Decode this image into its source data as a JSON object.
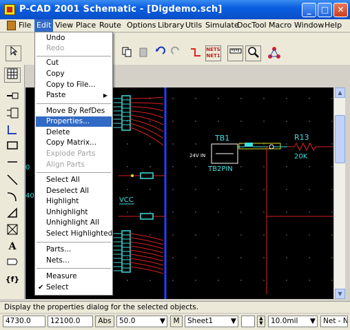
{
  "window": {
    "title": "P-CAD 2001 Schematic - [Digdemo.sch]"
  },
  "menubar": {
    "items": [
      "File",
      "Edit",
      "View",
      "Place",
      "Route",
      "Options",
      "Library",
      "Utils",
      "Simulate",
      "DocTool",
      "Macro",
      "Window",
      "Help"
    ],
    "active": "Edit"
  },
  "toolbar": {
    "nets_label": "NETS NET1"
  },
  "edit_menu": {
    "undo": "Undo",
    "redo": "Redo",
    "cut": "Cut",
    "copy": "Copy",
    "copy_to_file": "Copy to File...",
    "paste": "Paste",
    "move_by_refdes": "Move By RefDes",
    "properties": "Properties...",
    "delete": "Delete",
    "copy_matrix": "Copy Matrix...",
    "explode_parts": "Explode Parts",
    "align_parts": "Align Parts",
    "select_all": "Select All",
    "deselect_all": "Deselect All",
    "highlight": "Highlight",
    "unhighlight": "Unhighlight",
    "unhighlight_all": "Unhighlight All",
    "select_highlighted": "Select Highlighted",
    "parts": "Parts...",
    "nets": "Nets...",
    "measure": "Measure",
    "select": "Select"
  },
  "schematic": {
    "vcc_label": "VCC",
    "tb1_ref": "TB1",
    "tb1_voltage": "24V IN",
    "tb1_value": "TB2PIN",
    "r13_ref": "R13",
    "r13_value": "20K",
    "left_label_1": "0",
    "left_label_2": "40"
  },
  "status": {
    "message": "Display the properties dialog for the selected objects.",
    "x_coord": "4730.0",
    "y_coord": "12100.0",
    "abs_label": "Abs",
    "grid": "50.0",
    "m_label": "M",
    "sheet": "Sheet1",
    "line_width": "10.0mil",
    "net_field": "Net - NW"
  },
  "colors": {
    "highlight": "#316ac5",
    "canvas": "#000000",
    "bus": "#2040ff",
    "wire": "#e02020",
    "part": "#40e0e0"
  }
}
